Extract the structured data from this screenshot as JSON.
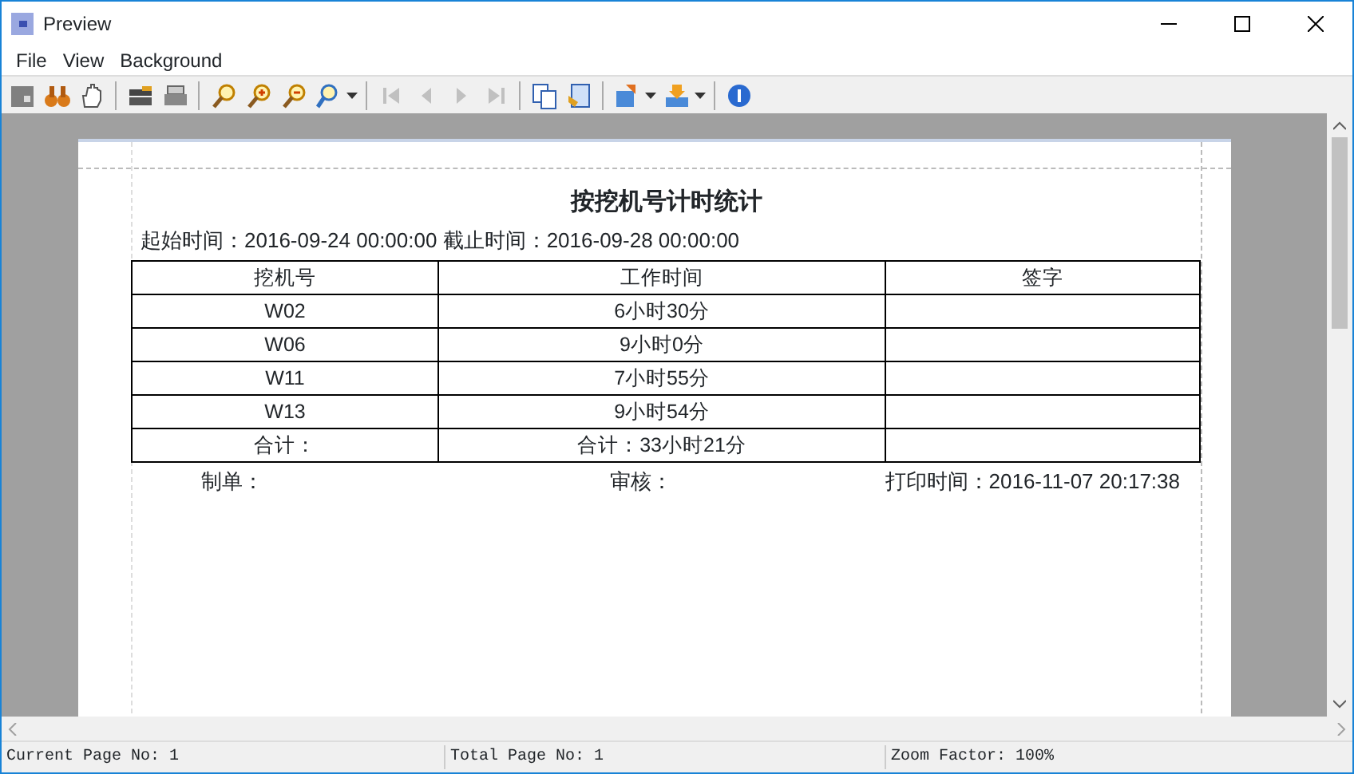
{
  "window": {
    "title": "Preview"
  },
  "menu": [
    {
      "label": "File"
    },
    {
      "label": "View"
    },
    {
      "label": "Background"
    }
  ],
  "toolbar": [
    {
      "kind": "page",
      "disabled": false
    },
    {
      "kind": "binoculars",
      "disabled": false
    },
    {
      "kind": "hand",
      "disabled": false
    },
    {
      "kind": "separator"
    },
    {
      "kind": "printer-setup",
      "disabled": false
    },
    {
      "kind": "printer",
      "disabled": false
    },
    {
      "kind": "separator"
    },
    {
      "kind": "zoom",
      "disabled": false
    },
    {
      "kind": "zoom-in",
      "disabled": false
    },
    {
      "kind": "zoom-out",
      "disabled": false
    },
    {
      "kind": "zoom-menu",
      "disabled": false
    },
    {
      "kind": "separator"
    },
    {
      "kind": "first",
      "disabled": true
    },
    {
      "kind": "prev",
      "disabled": true
    },
    {
      "kind": "next",
      "disabled": true
    },
    {
      "kind": "last",
      "disabled": true
    },
    {
      "kind": "separator"
    },
    {
      "kind": "copy",
      "disabled": false
    },
    {
      "kind": "open",
      "disabled": false
    },
    {
      "kind": "separator"
    },
    {
      "kind": "export-menu",
      "disabled": false
    },
    {
      "kind": "save-menu",
      "disabled": false
    },
    {
      "kind": "separator"
    },
    {
      "kind": "info",
      "disabled": false
    }
  ],
  "report": {
    "title": "按挖机号计时统计",
    "range": "起始时间：2016-09-24 00:00:00 截止时间：2016-09-28 00:00:00",
    "table": {
      "columns": [
        "挖机号",
        "工作时间",
        "签字"
      ],
      "rows": [
        [
          "W02",
          "6小时30分",
          ""
        ],
        [
          "W06",
          "9小时0分",
          ""
        ],
        [
          "W11",
          "7小时55分",
          ""
        ],
        [
          "W13",
          "9小时54分",
          ""
        ],
        [
          "合计：",
          "合计：33小时21分",
          ""
        ]
      ]
    },
    "footer": [
      "制单：",
      "审核：",
      "打印时间：2016-11-07 20:17:38"
    ]
  },
  "status_bar": [
    "Current Page No: 1",
    "Total Page No: 1",
    "Zoom Factor: 100%"
  ]
}
